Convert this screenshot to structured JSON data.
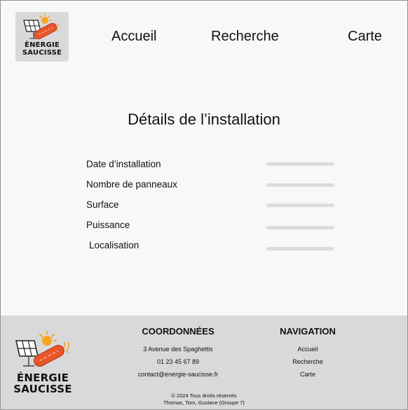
{
  "header": {
    "logo": {
      "line1": "ÉNERGIE",
      "line2": "SAUCISSE"
    },
    "nav": [
      "Accueil",
      "Recherche",
      "Carte"
    ]
  },
  "main": {
    "title": "Détails de l’installation",
    "rows": [
      {
        "label": "Date d’installation"
      },
      {
        "label": "Nombre de panneaux"
      },
      {
        "label": "Surface"
      },
      {
        "label": "Puissance"
      },
      {
        "label": "Localisation"
      }
    ]
  },
  "footer": {
    "logo": {
      "line1": "ÉNERGIE",
      "line2": "SAUCISSE"
    },
    "contact": {
      "heading": "COORDONNÉES",
      "address": "3 Avenue des Spaghettis",
      "phone": "01 23 45 67 89",
      "email": "contact@energie-saucisse.fr"
    },
    "navigation": {
      "heading": "NAVIGATION",
      "links": [
        "Accueil",
        "Recherche",
        "Carte"
      ]
    },
    "copyright": "©  2024 Tous droits réservés",
    "authors": "Thomas, Tom, Gustave  (Groupe 7)"
  },
  "colors": {
    "background": "#f8f8f8",
    "footer": "#d9d9d9",
    "placeholder_bar": "#dcdcdc",
    "sun": "#f5a623",
    "sausage": "#e8562a"
  }
}
